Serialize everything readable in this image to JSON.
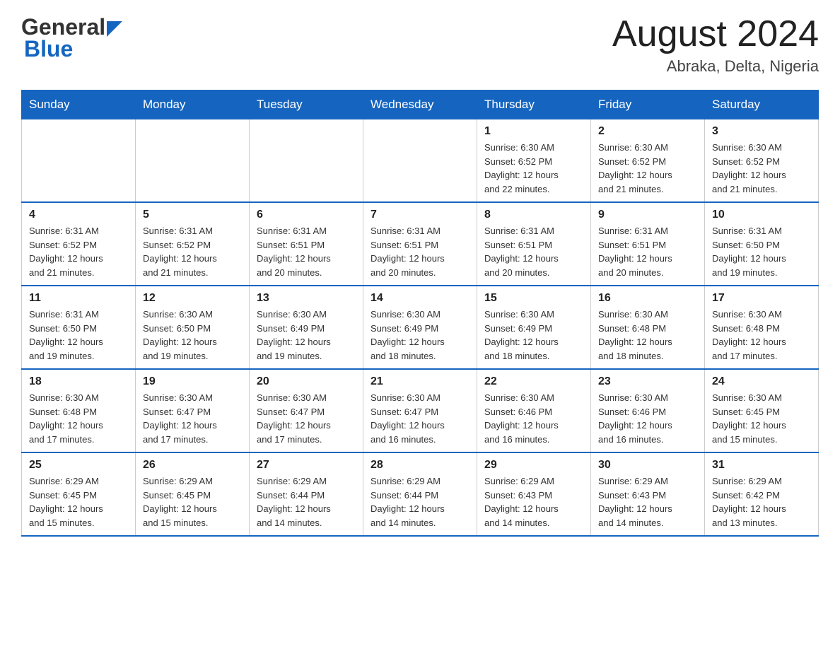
{
  "header": {
    "logo_general": "General",
    "logo_blue": "Blue",
    "month_title": "August 2024",
    "location": "Abraka, Delta, Nigeria"
  },
  "weekdays": [
    "Sunday",
    "Monday",
    "Tuesday",
    "Wednesday",
    "Thursday",
    "Friday",
    "Saturday"
  ],
  "weeks": [
    [
      {
        "day": "",
        "info": ""
      },
      {
        "day": "",
        "info": ""
      },
      {
        "day": "",
        "info": ""
      },
      {
        "day": "",
        "info": ""
      },
      {
        "day": "1",
        "info": "Sunrise: 6:30 AM\nSunset: 6:52 PM\nDaylight: 12 hours\nand 22 minutes."
      },
      {
        "day": "2",
        "info": "Sunrise: 6:30 AM\nSunset: 6:52 PM\nDaylight: 12 hours\nand 21 minutes."
      },
      {
        "day": "3",
        "info": "Sunrise: 6:30 AM\nSunset: 6:52 PM\nDaylight: 12 hours\nand 21 minutes."
      }
    ],
    [
      {
        "day": "4",
        "info": "Sunrise: 6:31 AM\nSunset: 6:52 PM\nDaylight: 12 hours\nand 21 minutes."
      },
      {
        "day": "5",
        "info": "Sunrise: 6:31 AM\nSunset: 6:52 PM\nDaylight: 12 hours\nand 21 minutes."
      },
      {
        "day": "6",
        "info": "Sunrise: 6:31 AM\nSunset: 6:51 PM\nDaylight: 12 hours\nand 20 minutes."
      },
      {
        "day": "7",
        "info": "Sunrise: 6:31 AM\nSunset: 6:51 PM\nDaylight: 12 hours\nand 20 minutes."
      },
      {
        "day": "8",
        "info": "Sunrise: 6:31 AM\nSunset: 6:51 PM\nDaylight: 12 hours\nand 20 minutes."
      },
      {
        "day": "9",
        "info": "Sunrise: 6:31 AM\nSunset: 6:51 PM\nDaylight: 12 hours\nand 20 minutes."
      },
      {
        "day": "10",
        "info": "Sunrise: 6:31 AM\nSunset: 6:50 PM\nDaylight: 12 hours\nand 19 minutes."
      }
    ],
    [
      {
        "day": "11",
        "info": "Sunrise: 6:31 AM\nSunset: 6:50 PM\nDaylight: 12 hours\nand 19 minutes."
      },
      {
        "day": "12",
        "info": "Sunrise: 6:30 AM\nSunset: 6:50 PM\nDaylight: 12 hours\nand 19 minutes."
      },
      {
        "day": "13",
        "info": "Sunrise: 6:30 AM\nSunset: 6:49 PM\nDaylight: 12 hours\nand 19 minutes."
      },
      {
        "day": "14",
        "info": "Sunrise: 6:30 AM\nSunset: 6:49 PM\nDaylight: 12 hours\nand 18 minutes."
      },
      {
        "day": "15",
        "info": "Sunrise: 6:30 AM\nSunset: 6:49 PM\nDaylight: 12 hours\nand 18 minutes."
      },
      {
        "day": "16",
        "info": "Sunrise: 6:30 AM\nSunset: 6:48 PM\nDaylight: 12 hours\nand 18 minutes."
      },
      {
        "day": "17",
        "info": "Sunrise: 6:30 AM\nSunset: 6:48 PM\nDaylight: 12 hours\nand 17 minutes."
      }
    ],
    [
      {
        "day": "18",
        "info": "Sunrise: 6:30 AM\nSunset: 6:48 PM\nDaylight: 12 hours\nand 17 minutes."
      },
      {
        "day": "19",
        "info": "Sunrise: 6:30 AM\nSunset: 6:47 PM\nDaylight: 12 hours\nand 17 minutes."
      },
      {
        "day": "20",
        "info": "Sunrise: 6:30 AM\nSunset: 6:47 PM\nDaylight: 12 hours\nand 17 minutes."
      },
      {
        "day": "21",
        "info": "Sunrise: 6:30 AM\nSunset: 6:47 PM\nDaylight: 12 hours\nand 16 minutes."
      },
      {
        "day": "22",
        "info": "Sunrise: 6:30 AM\nSunset: 6:46 PM\nDaylight: 12 hours\nand 16 minutes."
      },
      {
        "day": "23",
        "info": "Sunrise: 6:30 AM\nSunset: 6:46 PM\nDaylight: 12 hours\nand 16 minutes."
      },
      {
        "day": "24",
        "info": "Sunrise: 6:30 AM\nSunset: 6:45 PM\nDaylight: 12 hours\nand 15 minutes."
      }
    ],
    [
      {
        "day": "25",
        "info": "Sunrise: 6:29 AM\nSunset: 6:45 PM\nDaylight: 12 hours\nand 15 minutes."
      },
      {
        "day": "26",
        "info": "Sunrise: 6:29 AM\nSunset: 6:45 PM\nDaylight: 12 hours\nand 15 minutes."
      },
      {
        "day": "27",
        "info": "Sunrise: 6:29 AM\nSunset: 6:44 PM\nDaylight: 12 hours\nand 14 minutes."
      },
      {
        "day": "28",
        "info": "Sunrise: 6:29 AM\nSunset: 6:44 PM\nDaylight: 12 hours\nand 14 minutes."
      },
      {
        "day": "29",
        "info": "Sunrise: 6:29 AM\nSunset: 6:43 PM\nDaylight: 12 hours\nand 14 minutes."
      },
      {
        "day": "30",
        "info": "Sunrise: 6:29 AM\nSunset: 6:43 PM\nDaylight: 12 hours\nand 14 minutes."
      },
      {
        "day": "31",
        "info": "Sunrise: 6:29 AM\nSunset: 6:42 PM\nDaylight: 12 hours\nand 13 minutes."
      }
    ]
  ]
}
